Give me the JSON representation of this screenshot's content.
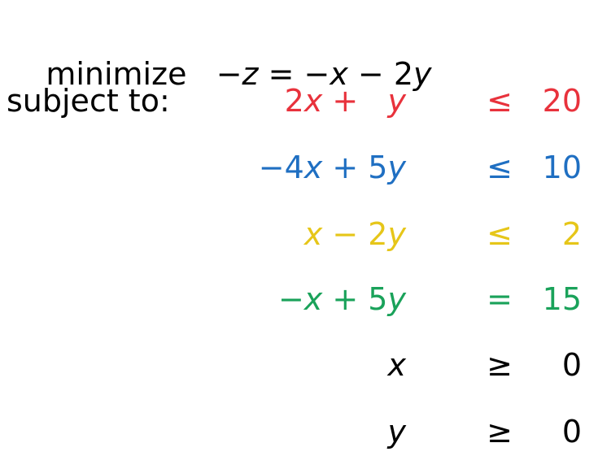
{
  "objective": {
    "keyword": "minimize",
    "neg1": "−",
    "z": "z",
    "eq": " = ",
    "neg2": "−",
    "x": "x",
    "minus": " − ",
    "coef": "2",
    "y": "y"
  },
  "subject_to": "subject to:",
  "constraints": [
    {
      "color": "#e8323c",
      "lhs": [
        {
          "t": "2",
          "i": false
        },
        {
          "t": "x",
          "i": true
        },
        {
          "t": " + ",
          "i": false
        },
        {
          "t": "  ",
          "i": false
        },
        {
          "t": "y",
          "i": true
        }
      ],
      "rel": "≤",
      "rhs": "20"
    },
    {
      "color": "#1f6fc2",
      "lhs": [
        {
          "t": "−4",
          "i": false
        },
        {
          "t": "x",
          "i": true
        },
        {
          "t": " + 5",
          "i": false
        },
        {
          "t": "y",
          "i": true
        }
      ],
      "rel": "≤",
      "rhs": "10"
    },
    {
      "color": "#e6c619",
      "lhs": [
        {
          "t": "x",
          "i": true
        },
        {
          "t": " − 2",
          "i": false
        },
        {
          "t": "y",
          "i": true
        }
      ],
      "rel": "≤",
      "rhs": "2"
    },
    {
      "color": "#1aa25a",
      "lhs": [
        {
          "t": "−",
          "i": false
        },
        {
          "t": "x",
          "i": true
        },
        {
          "t": " + 5",
          "i": false
        },
        {
          "t": "y",
          "i": true
        }
      ],
      "rel": "=",
      "rhs": "15"
    },
    {
      "color": "#000000",
      "lhs": [
        {
          "t": "x",
          "i": true
        }
      ],
      "rel": "≥",
      "rhs": "0"
    },
    {
      "color": "#000000",
      "lhs": [
        {
          "t": "y",
          "i": true
        }
      ],
      "rel": "≥",
      "rhs": "0"
    }
  ]
}
